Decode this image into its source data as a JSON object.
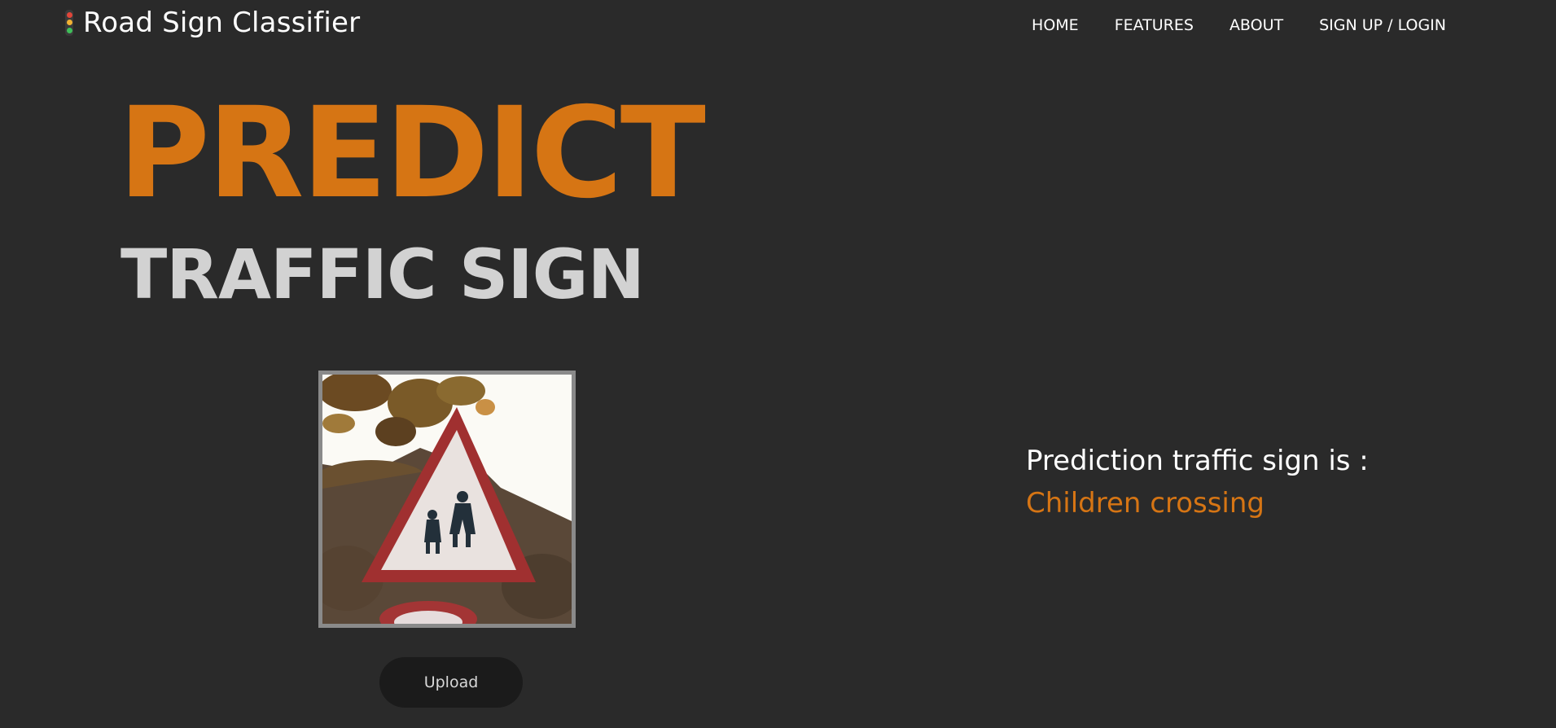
{
  "brand": {
    "title": "Road Sign Classifier",
    "icon": "traffic-light-icon"
  },
  "nav": {
    "items": [
      {
        "label": "HOME"
      },
      {
        "label": "FEATURES"
      },
      {
        "label": "ABOUT"
      },
      {
        "label": "SIGN UP / LOGIN"
      }
    ]
  },
  "hero": {
    "line1": "PREDICT",
    "line2": "TRAFFIC SIGN"
  },
  "upload": {
    "button_label": "Upload"
  },
  "prediction": {
    "label": "Prediction traffic sign is :",
    "result": "Children crossing"
  },
  "colors": {
    "background": "#2a2a2a",
    "accent": "#d67514",
    "secondary_text": "#d2d2d2",
    "button_bg": "#1b1b1b"
  }
}
